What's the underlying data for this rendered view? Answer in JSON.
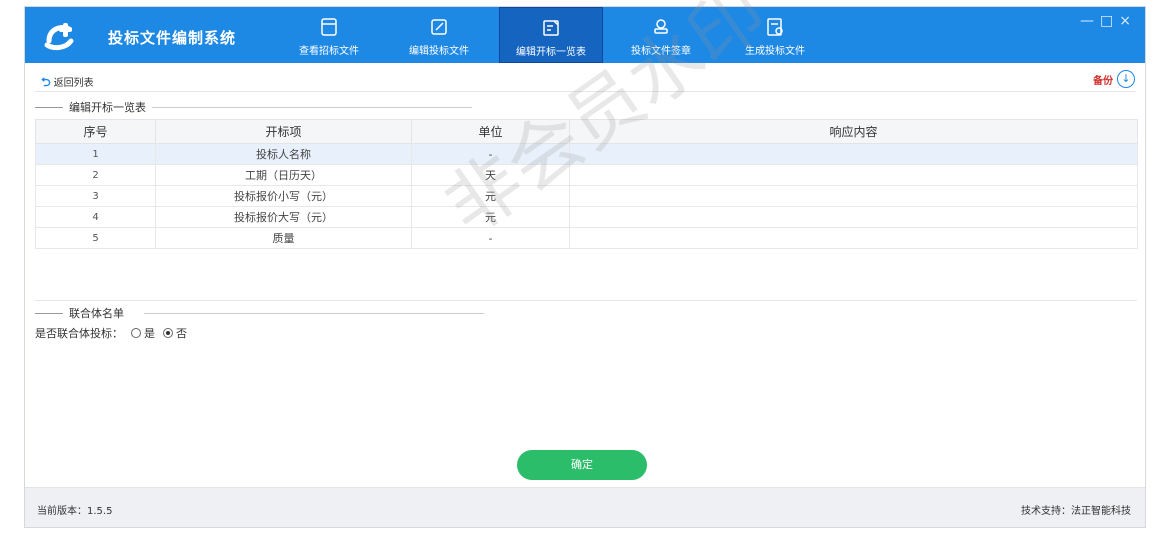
{
  "app": {
    "title": "投标文件编制系统",
    "window_controls": {
      "minimize": "—",
      "maximize": "□",
      "close": "×"
    }
  },
  "nav": {
    "items": [
      {
        "label": "查看招标文件",
        "icon": "document-view-icon"
      },
      {
        "label": "编辑投标文件",
        "icon": "edit-icon"
      },
      {
        "label": "编辑开标一览表",
        "icon": "edit-list-icon",
        "active": true
      },
      {
        "label": "投标文件签章",
        "icon": "stamp-icon"
      },
      {
        "label": "生成投标文件",
        "icon": "generate-file-icon"
      }
    ]
  },
  "toolbar": {
    "back_label": "返回列表",
    "backup_label": "备份"
  },
  "section": {
    "title": "编辑开标一览表"
  },
  "table": {
    "headers": [
      "序号",
      "开标项",
      "单位",
      "响应内容"
    ],
    "rows": [
      {
        "seq": "1",
        "item": "投标人名称",
        "unit": "-",
        "response": ""
      },
      {
        "seq": "2",
        "item": "工期（日历天）",
        "unit": "天",
        "response": ""
      },
      {
        "seq": "3",
        "item": "投标报价小写（元）",
        "unit": "元",
        "response": ""
      },
      {
        "seq": "4",
        "item": "投标报价大写（元）",
        "unit": "元",
        "response": ""
      },
      {
        "seq": "5",
        "item": "质量",
        "unit": "-",
        "response": ""
      }
    ]
  },
  "consortium": {
    "title": "联合体名单",
    "question": "是否联合体投标：",
    "options": [
      "是",
      "否"
    ],
    "selected": "否"
  },
  "confirm_label": "确定",
  "footer": {
    "version": "当前版本：1.5.5",
    "support": "技术支持：法正智能科技"
  },
  "watermark": "非会员水印",
  "colors": {
    "header_blue": "#1e88e5",
    "active_tab": "#1565c0",
    "confirm_green": "#2bbd6a",
    "backup_red": "#d32f2f"
  }
}
